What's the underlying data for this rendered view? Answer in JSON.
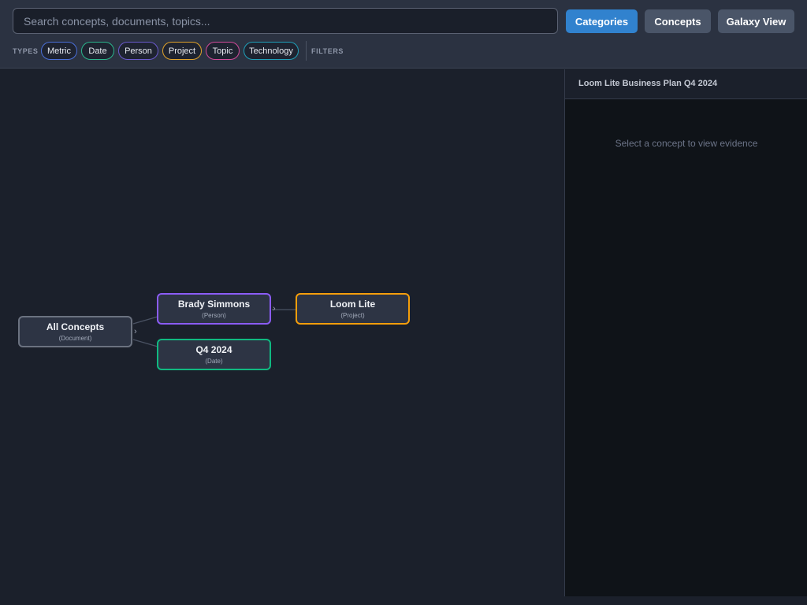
{
  "search": {
    "placeholder": "Search concepts, documents, topics..."
  },
  "view_buttons": {
    "categories": "Categories",
    "concepts": "Concepts",
    "galaxy": "Galaxy View",
    "active": "categories"
  },
  "filters": {
    "types_label": "TYPES",
    "filters_label": "FILTERS",
    "chips": [
      {
        "label": "Metric",
        "color": "#4a6fd8"
      },
      {
        "label": "Date",
        "color": "#2bb58c"
      },
      {
        "label": "Person",
        "color": "#6a5acd"
      },
      {
        "label": "Project",
        "color": "#e0a22a"
      },
      {
        "label": "Topic",
        "color": "#d14a9a"
      },
      {
        "label": "Technology",
        "color": "#1f9fb8"
      }
    ]
  },
  "graph": {
    "nodes": [
      {
        "id": "all",
        "label": "All Concepts",
        "type": "(Document)",
        "color": "#6b7280"
      },
      {
        "id": "brady",
        "label": "Brady Simmons",
        "type": "(Person)",
        "color": "#8b5cf6"
      },
      {
        "id": "q4",
        "label": "Q4 2024",
        "type": "(Date)",
        "color": "#10b981"
      },
      {
        "id": "loom",
        "label": "Loom Lite",
        "type": "(Project)",
        "color": "#f59e0b"
      }
    ],
    "expand_glyph": "›"
  },
  "panel": {
    "title": "Loom Lite Business Plan Q4 2024",
    "empty_message": "Select a concept to view evidence"
  }
}
